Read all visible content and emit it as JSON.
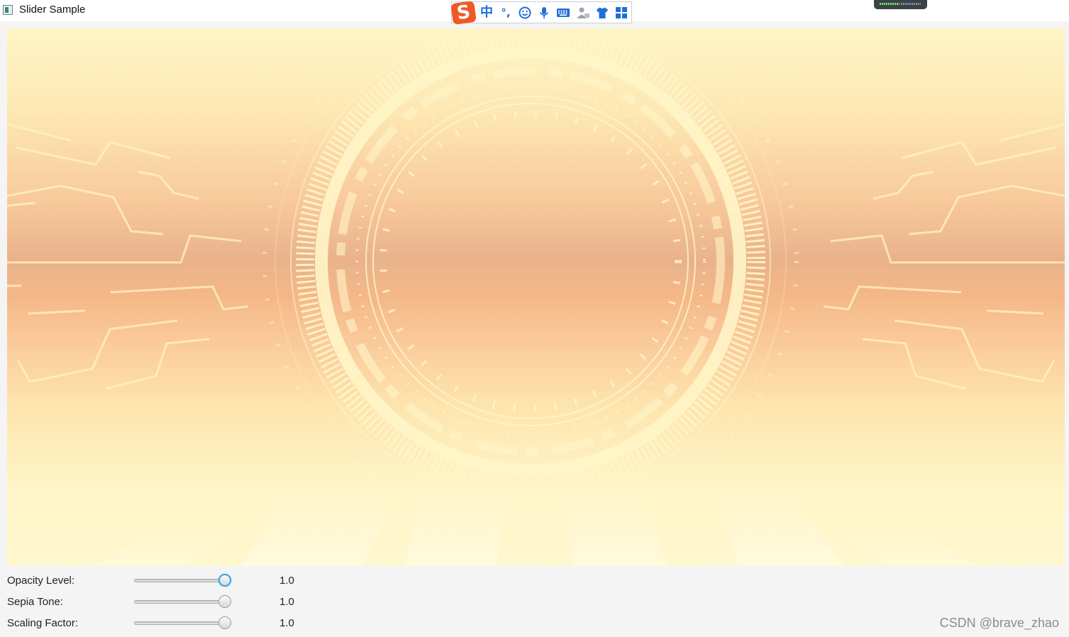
{
  "window": {
    "title": "Slider Sample"
  },
  "ime_toolbar": {
    "logo": "S",
    "items": [
      {
        "icon": "chinese-mode-icon",
        "glyph": "中"
      },
      {
        "icon": "punctuation-icon",
        "glyph": "°,"
      },
      {
        "icon": "emoji-icon"
      },
      {
        "icon": "microphone-icon"
      },
      {
        "icon": "keyboard-icon"
      },
      {
        "icon": "user-icon"
      },
      {
        "icon": "skin-shirt-icon"
      },
      {
        "icon": "toolbox-grid-icon"
      }
    ],
    "accent": "#1e6fd8",
    "logo_color": "#ef5a24"
  },
  "controls": [
    {
      "label": "Opacity Level:",
      "value_text": "1.0",
      "value": 1.0,
      "min": 0,
      "max": 1,
      "focused": true
    },
    {
      "label": "Sepia Tone:",
      "value_text": "1.0",
      "value": 1.0,
      "min": 0,
      "max": 1,
      "focused": false
    },
    {
      "label": "Scaling Factor:",
      "value_text": "1.0",
      "value": 1.0,
      "min": 0,
      "max": 1,
      "focused": false
    }
  ],
  "watermark": "CSDN @brave_zhao"
}
